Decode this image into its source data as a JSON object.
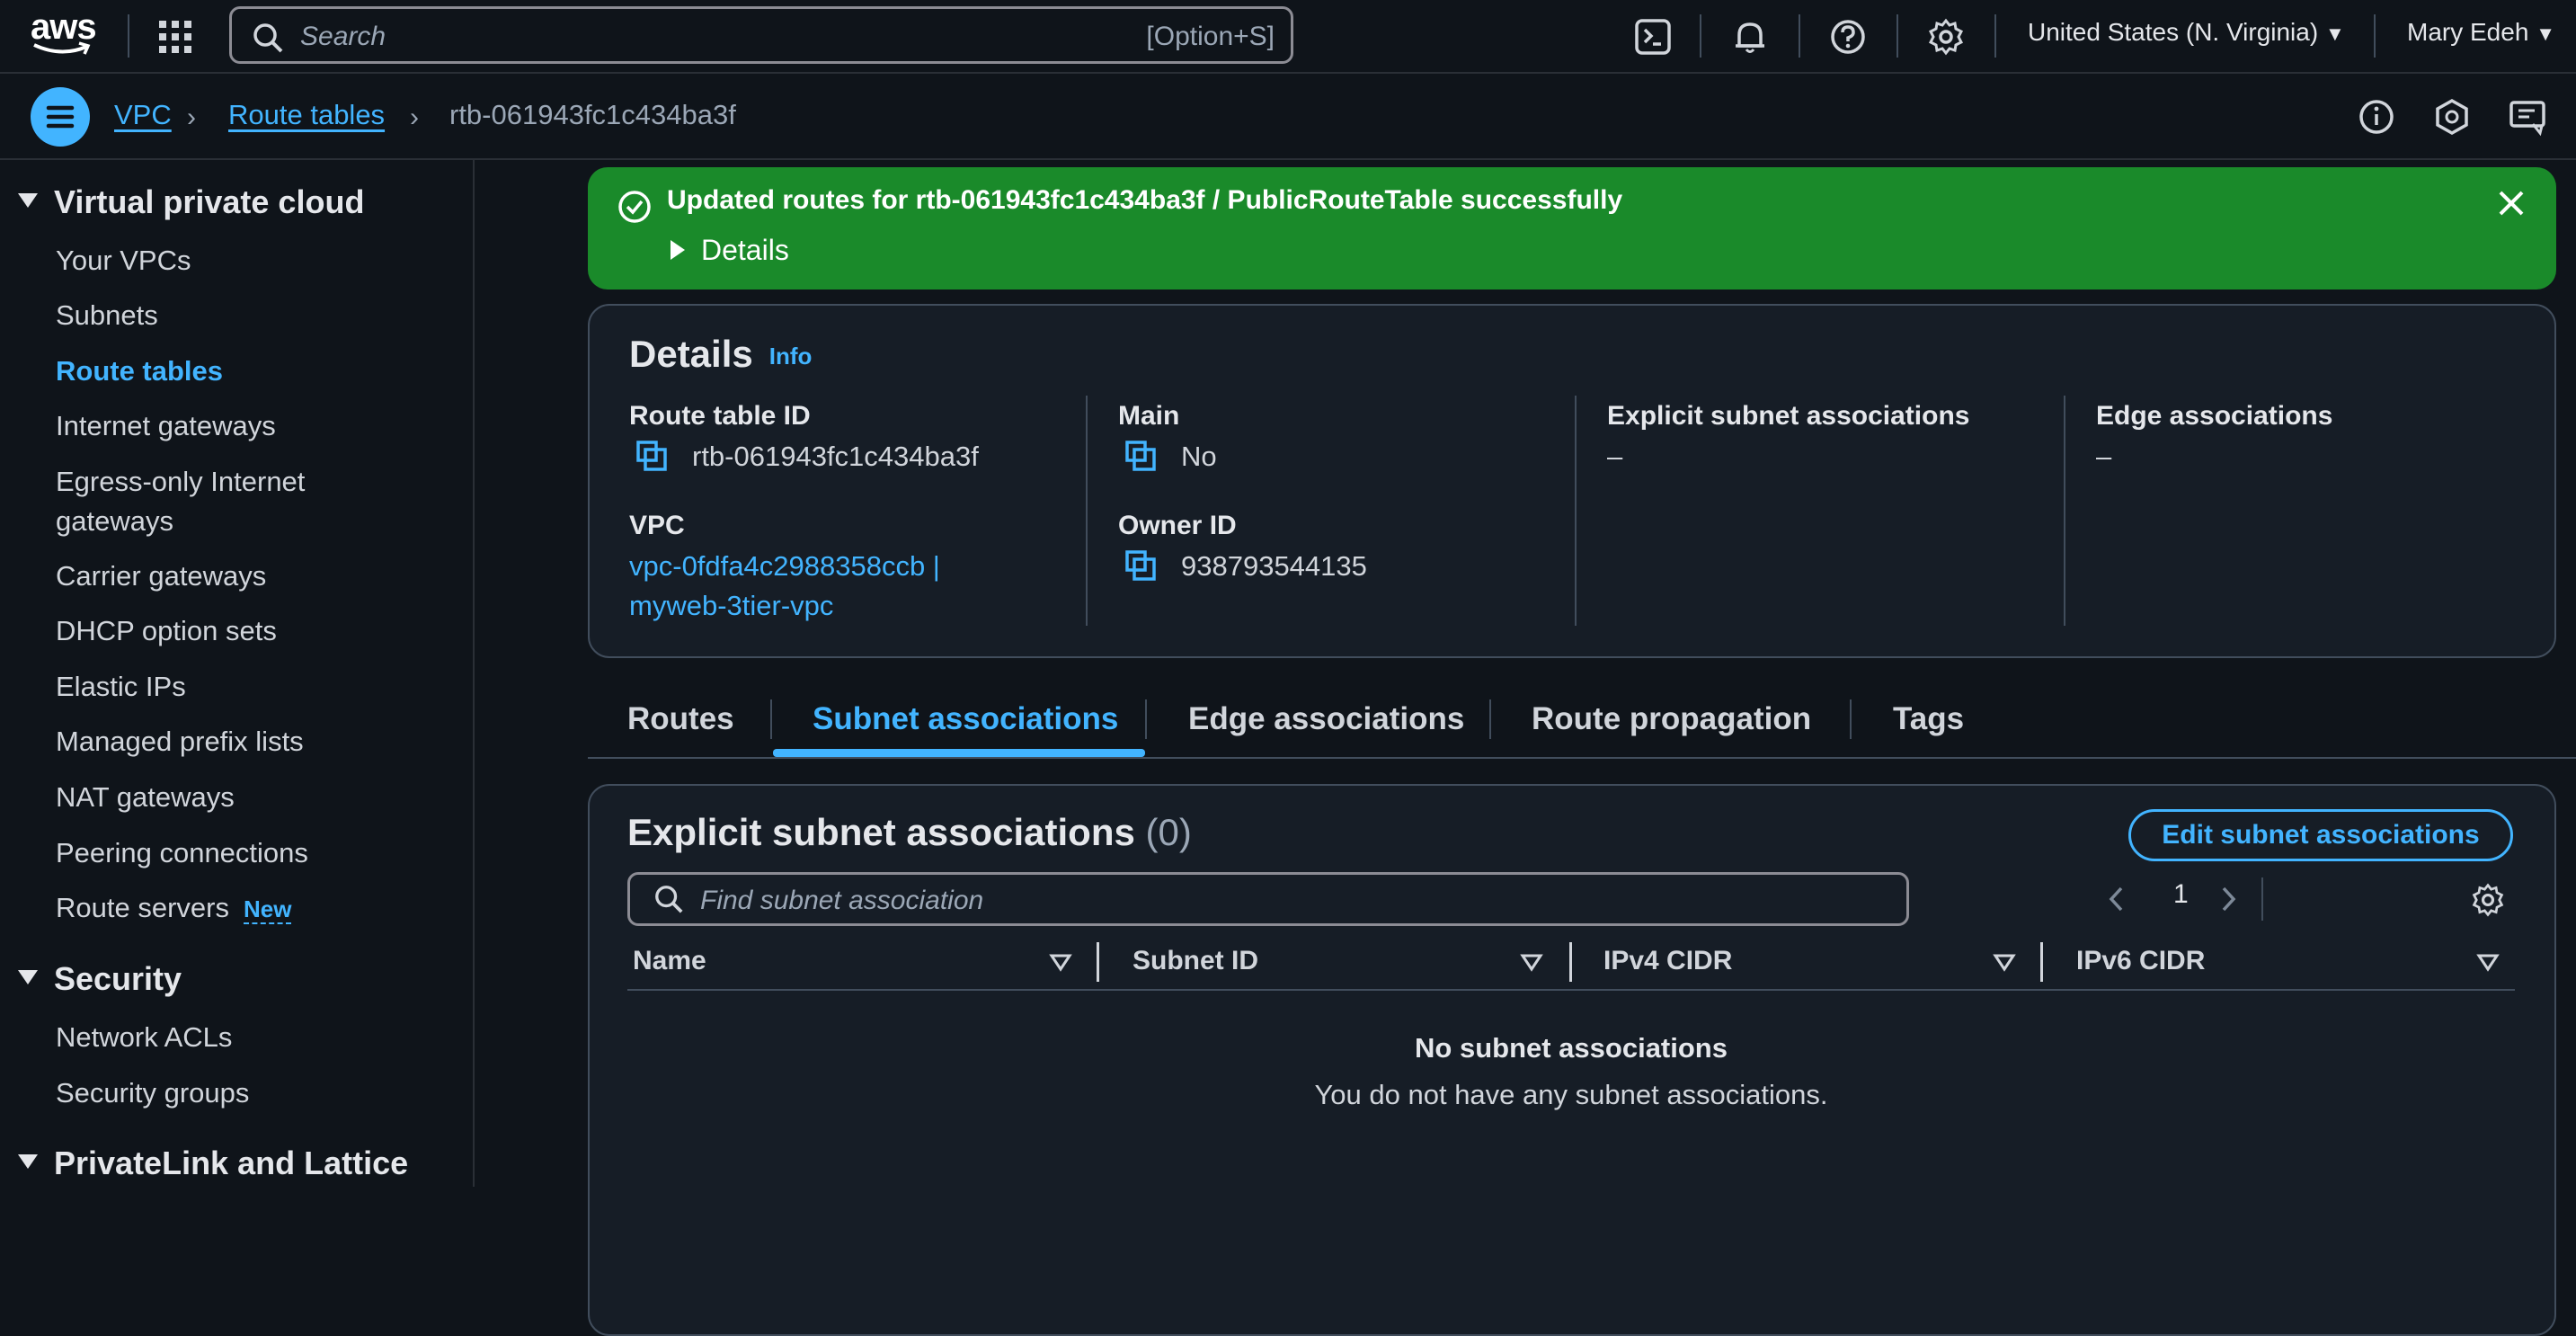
{
  "topbar": {
    "logo_text": "aws",
    "search_placeholder": "Search",
    "search_shortcut": "[Option+S]",
    "region": "United States (N. Virginia)",
    "user": "Mary Edeh"
  },
  "breadcrumb": {
    "items": [
      "VPC",
      "Route tables"
    ],
    "current": "rtb-061943fc1c434ba3f"
  },
  "sidebar": {
    "sections": [
      {
        "title": "Virtual private cloud",
        "items": [
          "Your VPCs",
          "Subnets",
          "Route tables",
          "Internet gateways",
          "Egress-only Internet",
          "gateways",
          "Carrier gateways",
          "DHCP option sets",
          "Elastic IPs",
          "Managed prefix lists",
          "NAT gateways",
          "Peering connections",
          "Route servers"
        ],
        "badge": "New"
      },
      {
        "title": "Security",
        "items": [
          "Network ACLs",
          "Security groups"
        ]
      },
      {
        "title": "PrivateLink and Lattice",
        "items": []
      }
    ]
  },
  "flash": {
    "message": "Updated routes for rtb-061943fc1c434ba3f / PublicRouteTable successfully",
    "details_label": "Details"
  },
  "details": {
    "title": "Details",
    "info": "Info",
    "route_table_id_label": "Route table ID",
    "route_table_id": "rtb-061943fc1c434ba3f",
    "main_label": "Main",
    "main": "No",
    "explicit_label": "Explicit subnet associations",
    "explicit": "–",
    "edge_label": "Edge associations",
    "edge": "–",
    "vpc_label": "VPC",
    "vpc_line1": "vpc-0fdfa4c2988358ccb |",
    "vpc_line2": "myweb-3tier-vpc",
    "owner_label": "Owner ID",
    "owner": "938793544135"
  },
  "tabs": [
    "Routes",
    "Subnet associations",
    "Edge associations",
    "Route propagation",
    "Tags"
  ],
  "active_tab": "Subnet associations",
  "subnets": {
    "title": "Explicit subnet associations",
    "count": "(0)",
    "edit_button": "Edit subnet associations",
    "filter_placeholder": "Find subnet association",
    "page": "1",
    "columns": [
      "Name",
      "Subnet ID",
      "IPv4 CIDR",
      "IPv6 CIDR"
    ],
    "empty_title": "No subnet associations",
    "empty_text": "You do not have any subnet associations."
  },
  "colors": {
    "accent": "#42b4ff",
    "success": "#1a8a2a",
    "background": "#0f141a"
  }
}
